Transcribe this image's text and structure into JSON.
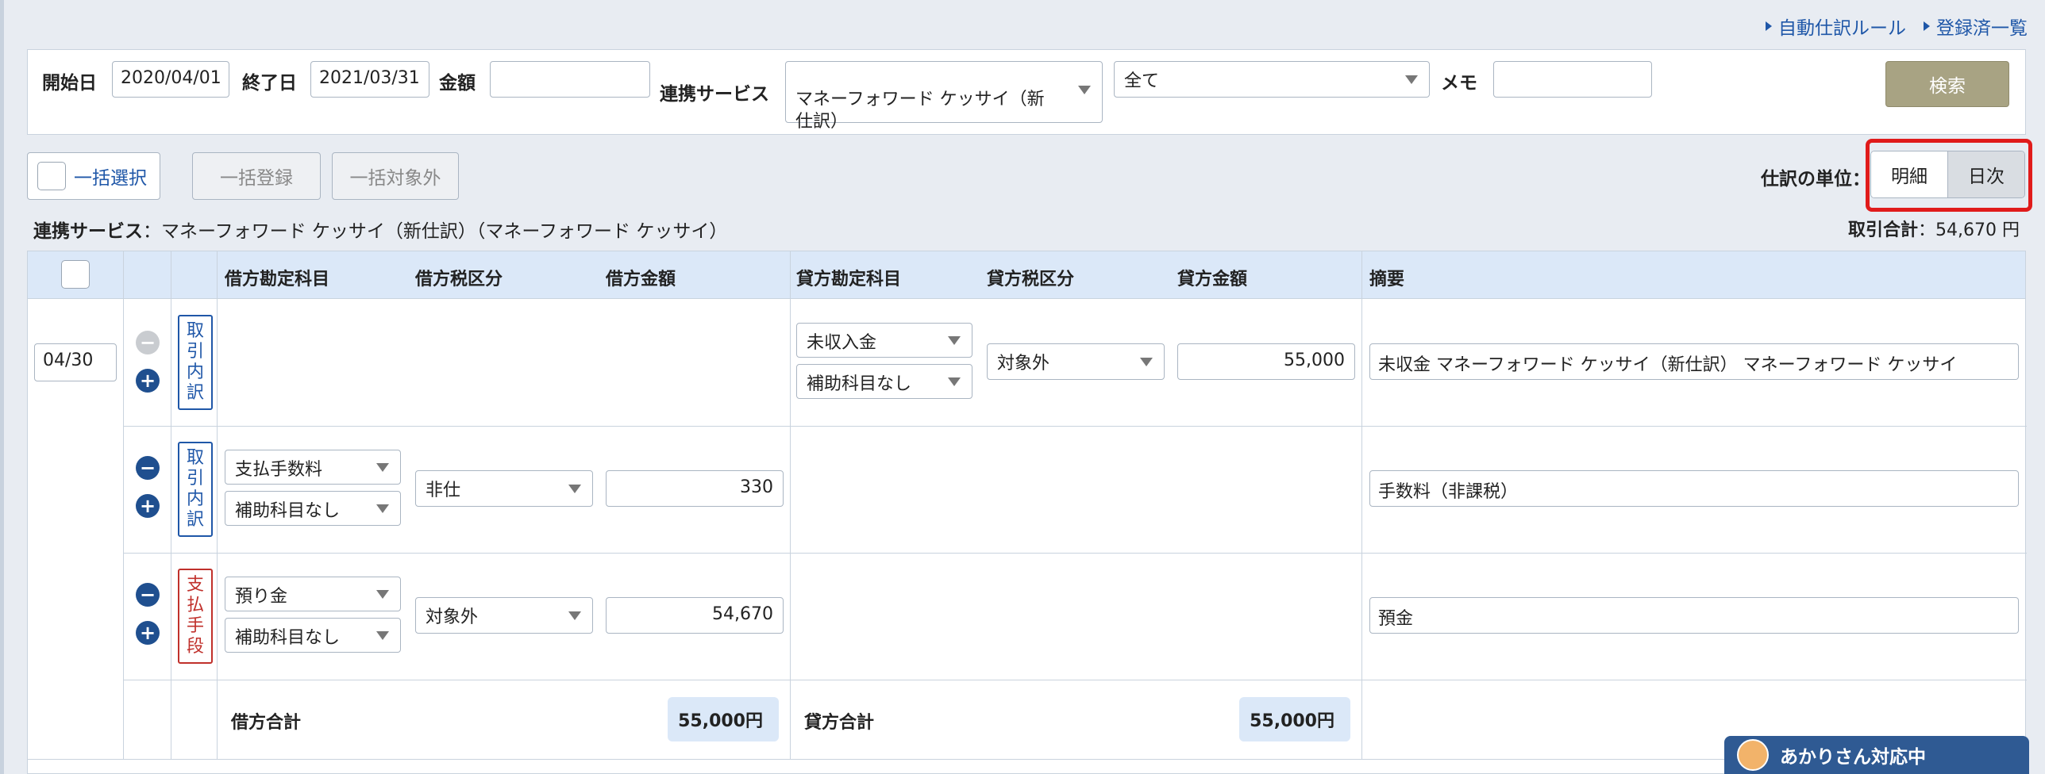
{
  "top_links": [
    "自動仕訳ルール",
    "登録済一覧"
  ],
  "search": {
    "start_label": "開始日",
    "start_value": "2020/04/01",
    "end_label": "終了日",
    "end_value": "2021/03/31",
    "amount_label": "金額",
    "amount_value": "",
    "service_label": "連携サービス",
    "service_value": "マネーフォワード ケッサイ（新\n仕訳）",
    "filter_value": "全て",
    "memo_label": "メモ",
    "memo_value": "",
    "search_button": "検索"
  },
  "toolbar": {
    "select_all": "一括選択",
    "bulk_register": "一括登録",
    "bulk_exclude": "一括対象外",
    "unit_label": "仕訳の単位：",
    "unit_options": [
      "明細",
      "日次"
    ],
    "unit_selected": "日次"
  },
  "service_line": {
    "label": "連携サービス",
    "value": "：マネーフォワード ケッサイ（新仕訳）（マネーフォワード ケッサイ）"
  },
  "total": {
    "label": "取引合計",
    "value": "：54,670 円"
  },
  "columns": [
    "借方勘定科目",
    "借方税区分",
    "借方金額",
    "貸方勘定科目",
    "貸方税区分",
    "貸方金額",
    "摘要"
  ],
  "date": "04/30",
  "rows": [
    {
      "category": "取引内訳",
      "debit_account": "",
      "debit_sub": "",
      "debit_tax": "",
      "debit_amount": "",
      "credit_account": "未収入金",
      "credit_sub": "補助科目なし",
      "credit_tax": "対象外",
      "credit_amount": "55,000",
      "memo": "未収金 マネーフォワード ケッサイ（新仕訳） マネーフォワード ケッサイ"
    },
    {
      "category": "取引内訳",
      "debit_account": "支払手数料",
      "debit_sub": "補助科目なし",
      "debit_tax": "非仕",
      "debit_amount": "330",
      "credit_account": "",
      "credit_sub": "",
      "credit_tax": "",
      "credit_amount": "",
      "memo": "手数料（非課税）"
    },
    {
      "category": "支払手段",
      "debit_account": "預り金",
      "debit_sub": "補助科目なし",
      "debit_tax": "対象外",
      "debit_amount": "54,670",
      "credit_account": "",
      "credit_sub": "",
      "credit_tax": "",
      "credit_amount": "",
      "memo": "預金"
    }
  ],
  "sums": {
    "debit_label": "借方合計",
    "debit_value": "55,000円",
    "credit_label": "貸方合計",
    "credit_value": "55,000円"
  },
  "chat": {
    "label": "あかりさん対応中"
  },
  "colors": {
    "accent": "#1f57a8",
    "header_bg": "#dbe8f8",
    "highlight": "#e01b1b",
    "search_button": "#a8a383"
  }
}
